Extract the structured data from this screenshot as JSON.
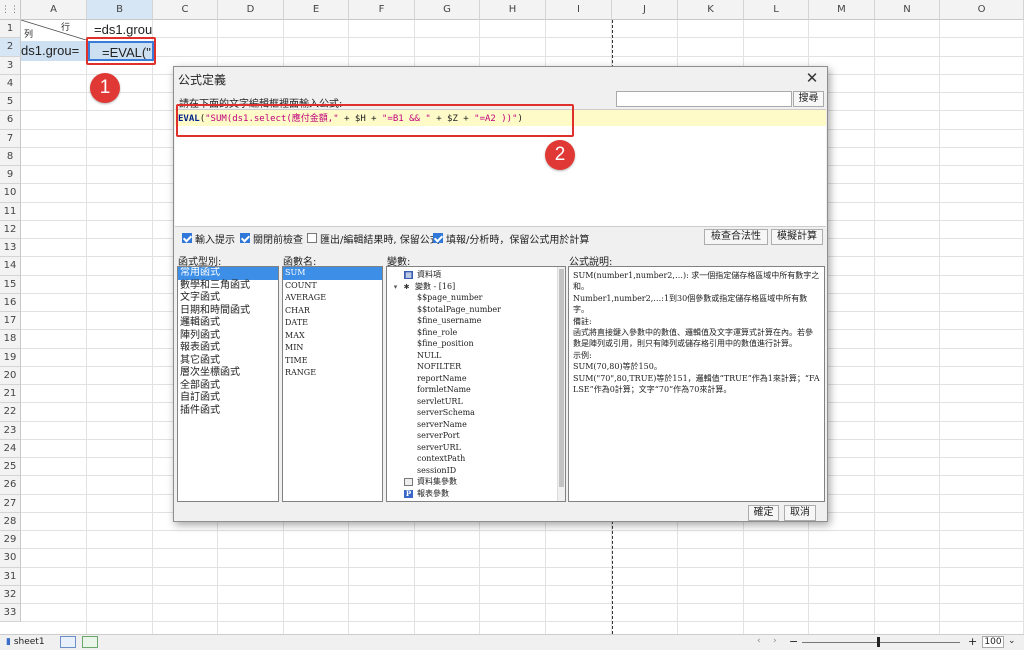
{
  "sheet": {
    "columns": [
      "A",
      "B",
      "C",
      "D",
      "E",
      "F",
      "G",
      "H",
      "I",
      "J",
      "K",
      "L",
      "M",
      "N",
      "O"
    ],
    "rows": [
      "1",
      "2",
      "3",
      "4",
      "5",
      "6",
      "7",
      "8",
      "9",
      "10",
      "11",
      "12",
      "13",
      "14",
      "15",
      "16",
      "17",
      "18",
      "19",
      "20",
      "21",
      "22",
      "23",
      "24",
      "25",
      "26",
      "27",
      "28",
      "29",
      "30",
      "31",
      "32",
      "33"
    ],
    "corner_icon": "grid-icon",
    "a1_row_label": "行",
    "a1_col_label": "列",
    "b1": "=ds1.grou",
    "a2": "=ds1.grou",
    "b2": "=EVAL(\"",
    "badge_1": "1",
    "badge_2": "2"
  },
  "dialog": {
    "title": "公式定義",
    "close": "✕",
    "prompt": "請在下面的文字編輯框裡面輸入公式:",
    "search_value": "",
    "search_button": "搜尋",
    "formula": {
      "kw": "EVAL",
      "p1": "(",
      "s1": "\"SUM(ds1.select(應付金額,\"",
      "p2": " + $H + ",
      "s2": "\"=B1 && \"",
      "p3": " + $Z + ",
      "s3": "\"=A2 ))\"",
      "p4": ")"
    },
    "options": [
      {
        "label": "輸入提示",
        "checked": true
      },
      {
        "label": "關閉前檢查",
        "checked": true
      },
      {
        "label": "匯出/編輯結果時, 保留公式",
        "checked": false
      },
      {
        "label": "填報/分析時，保留公式用於計算",
        "checked": true
      }
    ],
    "check_button": "檢查合法性",
    "simulate_button": "模擬計算",
    "labels": {
      "category": "函式型別:",
      "function": "函數名:",
      "variable": "變數:",
      "description": "公式說明:"
    },
    "categories": [
      "常用函式",
      "數學和三角函式",
      "文字函式",
      "日期和時間函式",
      "邏輯函式",
      "陣列函式",
      "報表函式",
      "其它函式",
      "層次坐標函式",
      "全部函式",
      "自訂函式",
      "插件函式"
    ],
    "functions": [
      "SUM",
      "COUNT",
      "AVERAGE",
      "CHAR",
      "DATE",
      "MAX",
      "MIN",
      "TIME",
      "RANGE"
    ],
    "variables": {
      "data_items": "資料項",
      "variables_group": "變數 - [16]",
      "items": [
        "$$page_number",
        "$$totalPage_number",
        "$fine_username",
        "$fine_role",
        "$fine_position",
        "NULL",
        "NOFILTER",
        "reportName",
        "formletName",
        "servletURL",
        "serverSchema",
        "serverName",
        "serverPort",
        "serverURL",
        "contextPath",
        "sessionID"
      ],
      "dataset_params": "資料集參數",
      "report_params": "報表參數"
    },
    "description": "SUM(number1,number2,…): 求一個指定儲存格區域中所有數字之和。\nNumber1,number2,…:1到30個參數或指定儲存格區域中所有數字。\n備註:\n函式將直接鍵入參數中的數值、邏輯值及文字運算式計算在內。若參數是陣列或引用，則只有陣列或儲存格引用中的數值進行計算。\n示例:\nSUM(70,80)等於150。\nSUM(\"70\",80,TRUE)等於151，邏輯值“TRUE”作為1來計算；“FALSE”作為0計算；文字“70”作為70來計算。",
    "ok_button": "確定",
    "cancel_button": "取消"
  },
  "status": {
    "sheet_tab": "sheet1",
    "nav_left": "‹",
    "nav_right": "›",
    "zoom_minus": "−",
    "zoom_plus": "+",
    "zoom_value": "100"
  }
}
